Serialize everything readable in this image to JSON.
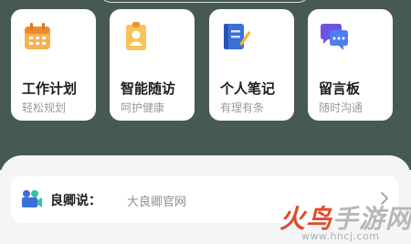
{
  "cards": [
    {
      "title": "工作计划",
      "subtitle": "轻松规划",
      "icon": "calendar-icon"
    },
    {
      "title": "智能随访",
      "subtitle": "呵护健康",
      "icon": "id-badge-icon"
    },
    {
      "title": "个人笔记",
      "subtitle": "有理有条",
      "icon": "notebook-icon"
    },
    {
      "title": "留言板",
      "subtitle": "随时沟通",
      "icon": "chat-bubbles-icon"
    }
  ],
  "notice": {
    "label": "良卿说：",
    "text": "大良卿官网",
    "icon": "video-camera-icon"
  },
  "watermark": {
    "part1": "火鸟",
    "part2": "手游网",
    "url": "www.hncj.com"
  },
  "colors": {
    "header_bg": "#465a52",
    "page_bg": "#f4f5f6",
    "card_bg": "#ffffff",
    "accent_orange": "#f5a23c",
    "accent_blue": "#3b6fd8",
    "accent_purple": "#6e55e0",
    "watermark_red": "#e04a2a"
  }
}
